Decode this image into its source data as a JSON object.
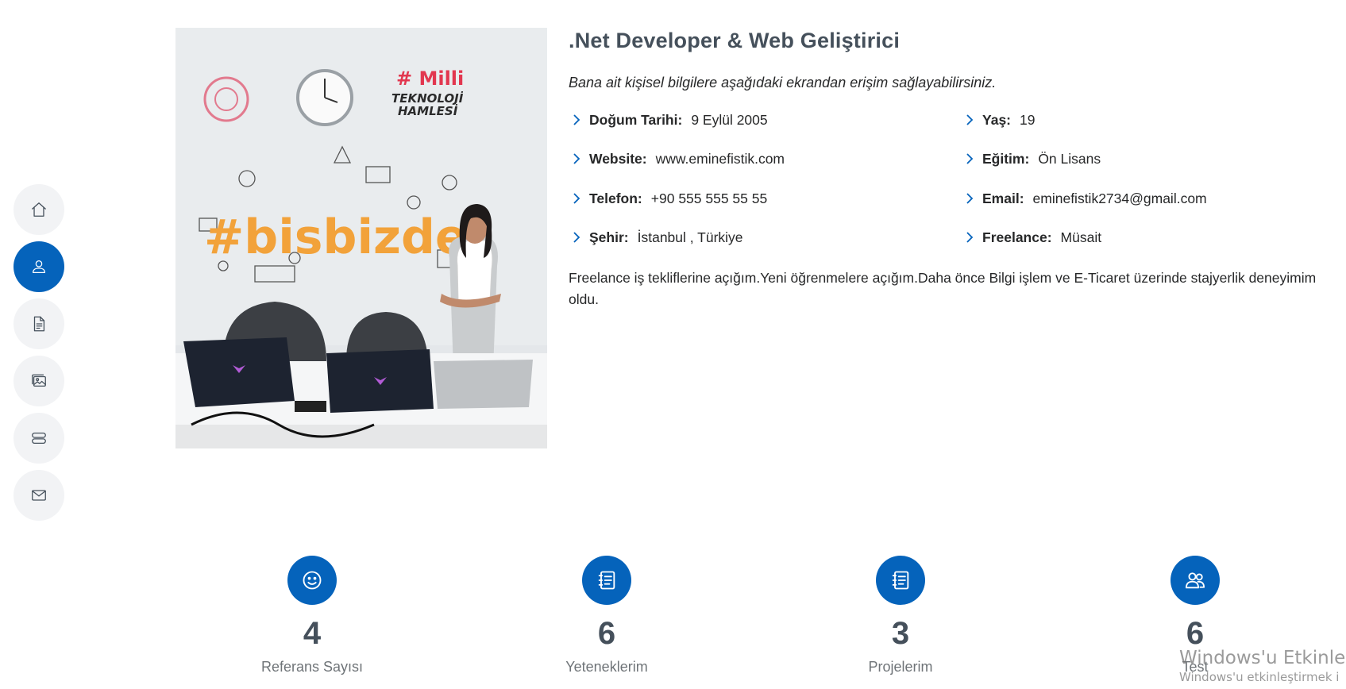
{
  "nav": {
    "items": [
      {
        "icon": "house-icon",
        "active": false
      },
      {
        "icon": "user-icon",
        "active": true
      },
      {
        "icon": "document-icon",
        "active": false
      },
      {
        "icon": "image-icon",
        "active": false
      },
      {
        "icon": "server-icon",
        "active": false
      },
      {
        "icon": "envelope-icon",
        "active": false
      }
    ]
  },
  "photo": {
    "wall_text_main": "#bisbizde",
    "wall_text_badge_1": "# Milli",
    "wall_text_badge_2": "TEKNOLOJİ",
    "wall_text_badge_3": "HAMLESİ"
  },
  "about": {
    "headline": ".Net Developer & Web Geliştirici",
    "intro": "Bana ait kişisel bilgilere aşağıdaki ekrandan erişim sağlayabilirsiniz.",
    "fields": [
      {
        "label": "Doğum Tarihi:",
        "value": "9 Eylül 2005"
      },
      {
        "label": "Yaş:",
        "value": "19"
      },
      {
        "label": "Website:",
        "value": "www.eminefistik.com"
      },
      {
        "label": "Eğitim:",
        "value": "Ön Lisans"
      },
      {
        "label": "Telefon:",
        "value": "+90 555 555 55 55"
      },
      {
        "label": "Email:",
        "value": "eminefistik2734@gmail.com"
      },
      {
        "label": "Şehir:",
        "value": "İstanbul , Türkiye"
      },
      {
        "label": "Freelance:",
        "value": "Müsait"
      }
    ],
    "description": "Freelance iş tekliflerine açığım.Yeni öğrenmelere açığım.Daha önce Bilgi işlem ve E-Ticaret üzerinde stajyerlik deneyimim oldu."
  },
  "stats": [
    {
      "icon": "smiley-icon",
      "number": "4",
      "label": "Referans Sayısı"
    },
    {
      "icon": "journal-icon",
      "number": "6",
      "label": "Yeteneklerim"
    },
    {
      "icon": "journal-icon",
      "number": "3",
      "label": "Projelerim"
    },
    {
      "icon": "people-icon",
      "number": "6",
      "label": "Test"
    }
  ],
  "watermark": {
    "line1": "Windows'u Etkinleş",
    "line2": "Windows'u etkinleştirmek i"
  },
  "colors": {
    "accent": "#0563bb",
    "heading": "#45505b",
    "nav_bg": "#f2f3f5"
  }
}
